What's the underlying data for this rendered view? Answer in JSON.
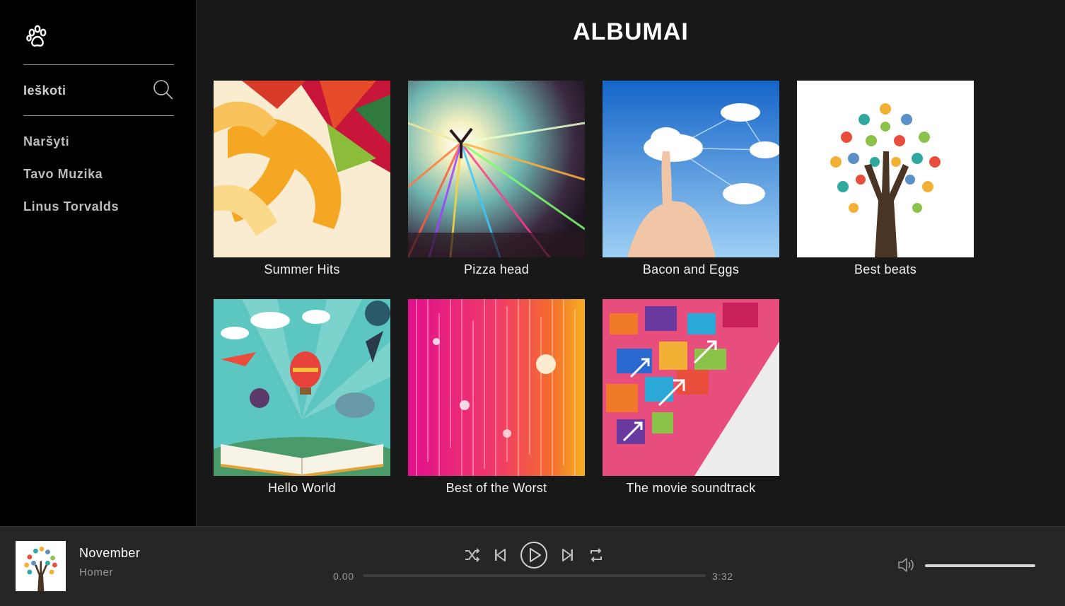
{
  "sidebar": {
    "logo_icon": "paw-icon",
    "search_label": "Ieškoti",
    "nav_items": [
      "Naršyti",
      "Tavo Muzika",
      "Linus Torvalds"
    ]
  },
  "main": {
    "title": "ALBUMAI",
    "albums": [
      {
        "title": "Summer Hits"
      },
      {
        "title": "Pizza head"
      },
      {
        "title": "Bacon and Eggs"
      },
      {
        "title": "Best beats"
      },
      {
        "title": "Hello World"
      },
      {
        "title": "Best of the Worst"
      },
      {
        "title": "The movie soundtrack"
      }
    ]
  },
  "player": {
    "track_title": "November",
    "artist": "Homer",
    "current_time": "0.00",
    "duration": "3:32",
    "progress": 0,
    "volume": 1.0,
    "controls": [
      "shuffle-icon",
      "previous-icon",
      "play-icon",
      "next-icon",
      "repeat-icon"
    ]
  },
  "colors": {
    "sidebar_bg": "#000000",
    "main_bg": "#181818",
    "player_bg": "#262626"
  }
}
